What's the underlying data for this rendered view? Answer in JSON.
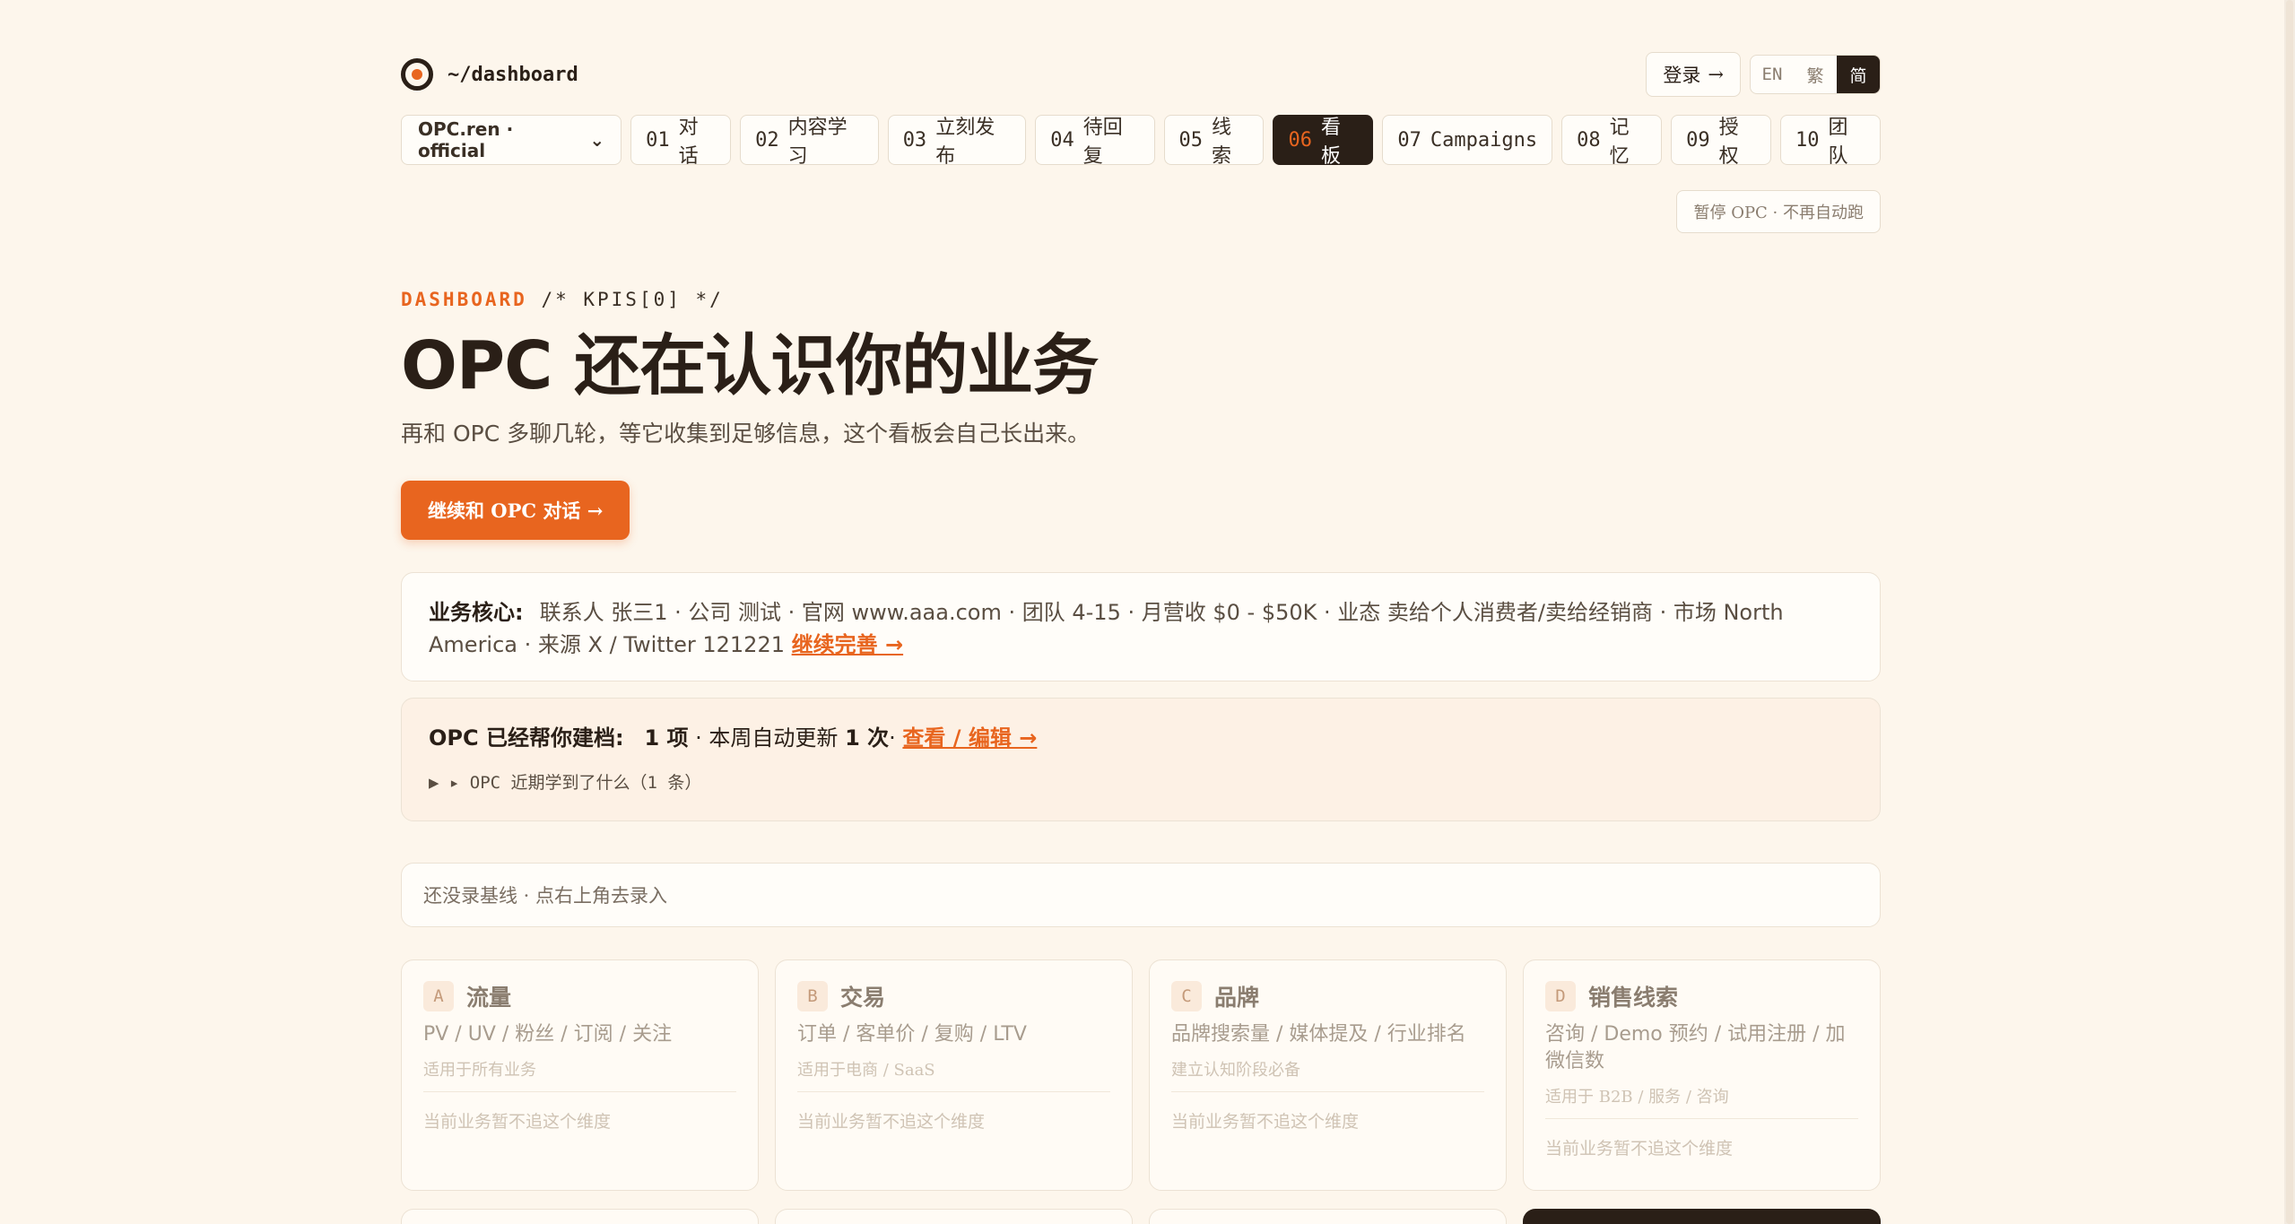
{
  "header": {
    "path": "~/dashboard",
    "login_label": "登录",
    "login_arrow": "→",
    "langs": [
      "EN",
      "繁",
      "简"
    ],
    "active_lang": "简"
  },
  "nav": {
    "org": "OPC.ren · official",
    "org_chevron": "⌄",
    "tabs": [
      {
        "num": "01",
        "label": "对话"
      },
      {
        "num": "02",
        "label": "内容学习"
      },
      {
        "num": "03",
        "label": "立刻发布"
      },
      {
        "num": "04",
        "label": "待回复"
      },
      {
        "num": "05",
        "label": "线索"
      },
      {
        "num": "06",
        "label": "看板"
      },
      {
        "num": "07",
        "label": "Campaigns"
      },
      {
        "num": "08",
        "label": "记忆"
      },
      {
        "num": "09",
        "label": "授权"
      },
      {
        "num": "10",
        "label": "团队"
      }
    ],
    "active_tab": "06"
  },
  "pause_button": "暂停 OPC · 不再自动跑",
  "hero": {
    "eyebrow_highlight": "DASHBOARD",
    "eyebrow_rest": "/* KPIS[0] */",
    "title": "OPC 还在认识你的业务",
    "subtitle": "再和 OPC 多聊几轮，等它收集到足够信息，这个看板会自己长出来。",
    "cta": "继续和 OPC 对话 →"
  },
  "core": {
    "label": "业务核心:",
    "text": "联系人 张三1 · 公司 测试 · 官网 www.aaa.com · 团队 4-15 · 月营收 $0 - $50K · 业态 卖给个人消费者/卖给经销商 · 市场 North America · 来源 X / Twitter 121221",
    "link": "继续完善 →"
  },
  "archive": {
    "label": "OPC 已经帮你建档:",
    "count": "1 项",
    "mid": "· 本周自动更新",
    "updates": "1 次",
    "sep": "·",
    "link": "查看 / 编辑 →",
    "toggle": "▶ ▸ OPC 近期学到了什么（1 条）"
  },
  "baseline": "还没录基线 · 点右上角去录入",
  "dimensions": [
    {
      "letter": "A",
      "title": "流量",
      "metrics": "PV / UV / 粉丝 / 订阅 / 关注",
      "fit": "适用于所有业务",
      "status": "当前业务暂不追这个维度"
    },
    {
      "letter": "B",
      "title": "交易",
      "metrics": "订单 / 客单价 / 复购 / LTV",
      "fit": "适用于电商 / SaaS",
      "status": "当前业务暂不追这个维度"
    },
    {
      "letter": "C",
      "title": "品牌",
      "metrics": "品牌搜索量 / 媒体提及 / 行业排名",
      "fit": "建立认知阶段必备",
      "status": "当前业务暂不追这个维度"
    },
    {
      "letter": "D",
      "title": "销售线索",
      "metrics": "咨询 / Demo 预约 / 试用注册 / 加微信数",
      "fit": "适用于 B2B / 服务 / 咨询",
      "status": "当前业务暂不追这个维度"
    }
  ],
  "colors": {
    "accent": "#e8651f",
    "dark": "#2a1f17",
    "background": "#fdf6ec"
  }
}
